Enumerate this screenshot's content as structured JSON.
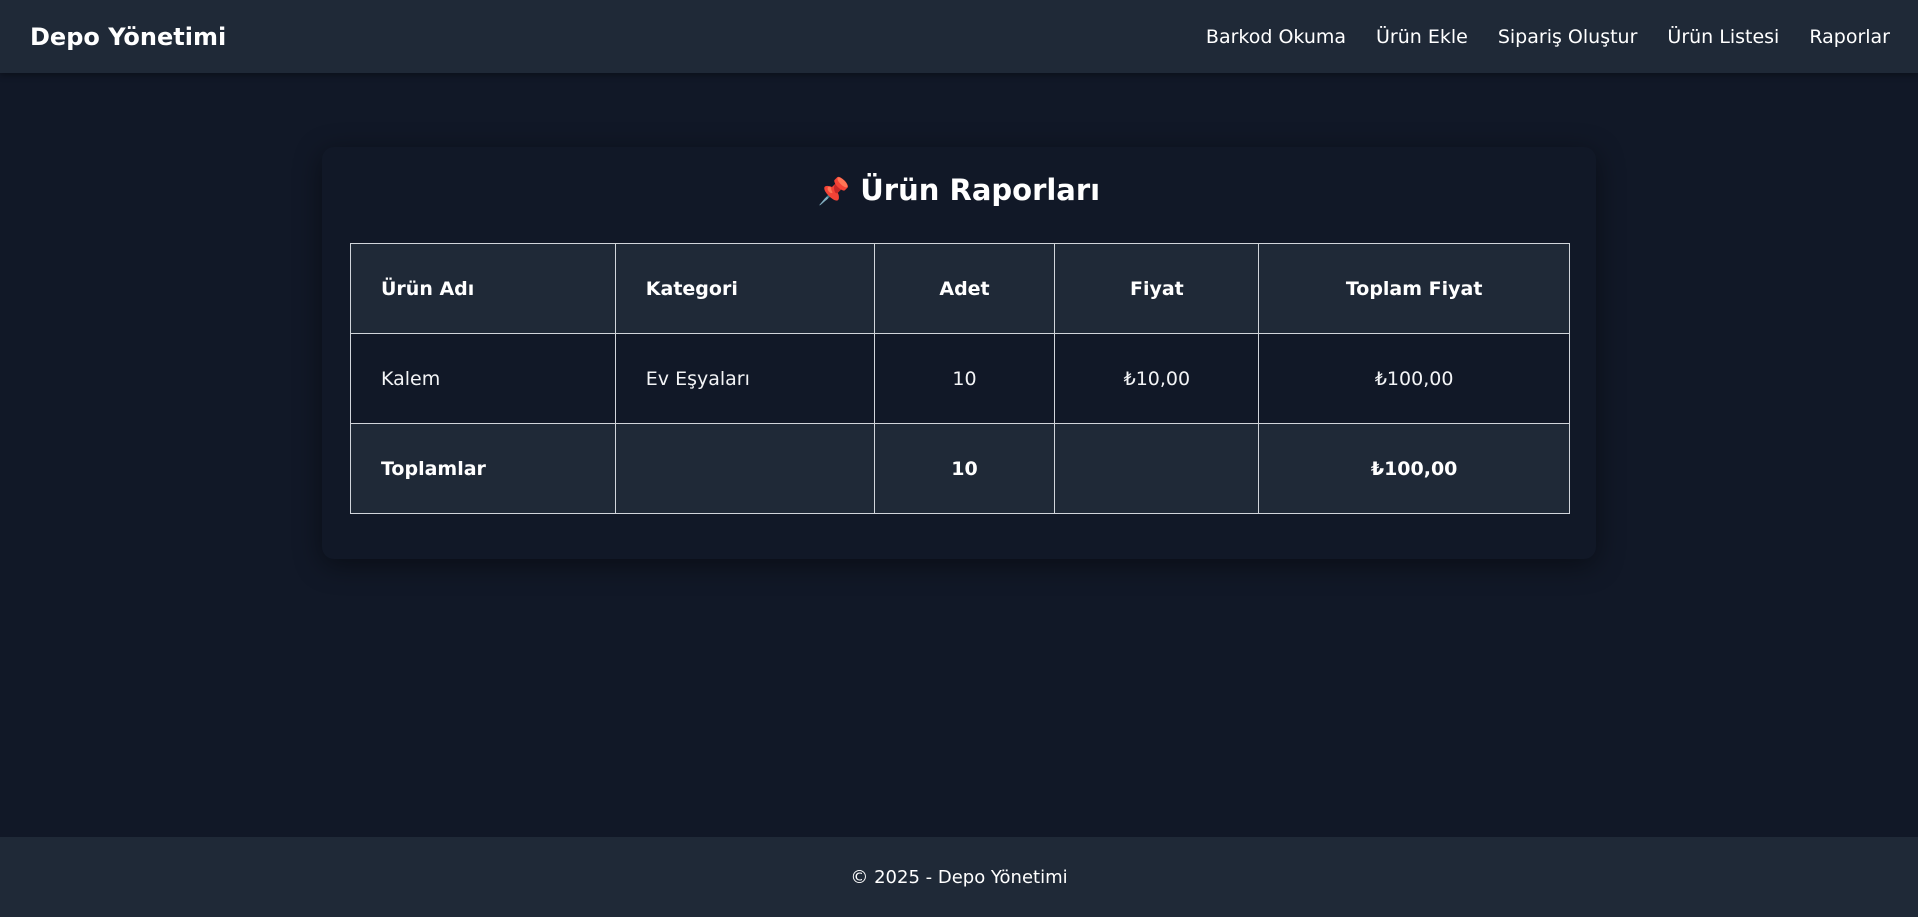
{
  "navbar": {
    "brand": "Depo Yönetimi",
    "links": [
      {
        "label": "Barkod Okuma"
      },
      {
        "label": "Ürün Ekle"
      },
      {
        "label": "Sipariş Oluştur"
      },
      {
        "label": "Ürün Listesi"
      },
      {
        "label": "Raporlar"
      }
    ]
  },
  "report": {
    "title": "Ürün Raporları",
    "title_icon": "📌",
    "columns": [
      "Ürün Adı",
      "Kategori",
      "Adet",
      "Fiyat",
      "Toplam Fiyat"
    ],
    "rows": [
      {
        "name": "Kalem",
        "category": "Ev Eşyaları",
        "quantity": "10",
        "price": "₺10,00",
        "total": "₺100,00"
      }
    ],
    "totals": {
      "label": "Toplamlar",
      "category": "",
      "quantity": "10",
      "price": "",
      "total": "₺100,00"
    }
  },
  "footer": {
    "text": "© 2025 - Depo Yönetimi"
  }
}
